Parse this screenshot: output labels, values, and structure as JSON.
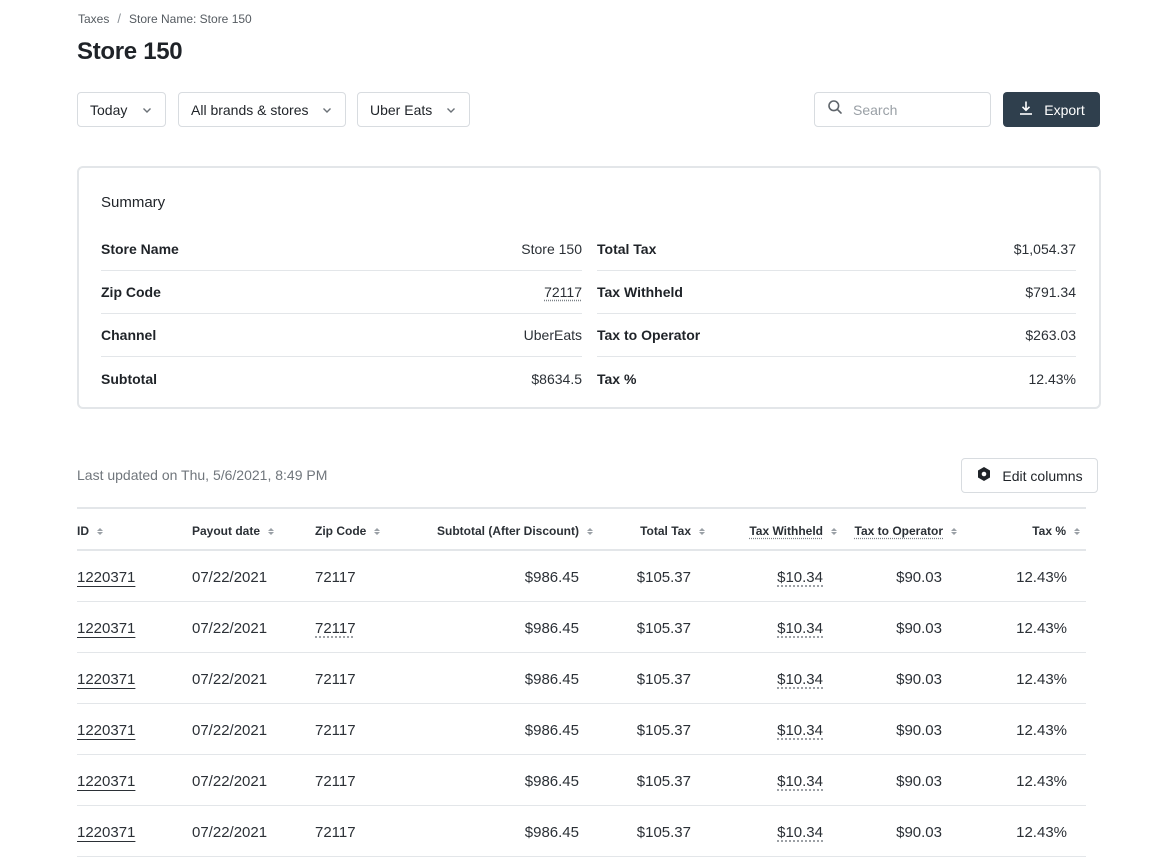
{
  "breadcrumb": {
    "root": "Taxes",
    "separator": "/",
    "current": "Store Name: Store 150"
  },
  "page_title": "Store 150",
  "filters": {
    "date": "Today",
    "brands": "All brands & stores",
    "channel": "Uber Eats"
  },
  "search": {
    "placeholder": "Search",
    "value": ""
  },
  "export_label": "Export",
  "summary": {
    "title": "Summary",
    "left": [
      {
        "label": "Store Name",
        "value": "Store 150"
      },
      {
        "label": "Zip Code",
        "value": "72117"
      },
      {
        "label": "Channel",
        "value": "UberEats"
      },
      {
        "label": "Subtotal",
        "value": "$8634.5"
      }
    ],
    "right": [
      {
        "label": "Total Tax",
        "value": "$1,054.37"
      },
      {
        "label": "Tax Withheld",
        "value": "$791.34"
      },
      {
        "label": "Tax to Operator",
        "value": "$263.03"
      },
      {
        "label": "Tax %",
        "value": "12.43%"
      }
    ]
  },
  "last_updated": "Last updated on Thu, 5/6/2021, 8:49 PM",
  "edit_columns_label": "Edit columns",
  "table": {
    "columns": [
      "ID",
      "Payout date",
      "Zip Code",
      "Subtotal (After Discount)",
      "Total Tax",
      "Tax Withheld",
      "Tax to Operator",
      "Tax %"
    ],
    "rows": [
      [
        "1220371",
        "07/22/2021",
        "72117",
        "$986.45",
        "$105.37",
        "$10.34",
        "$90.03",
        "12.43%"
      ],
      [
        "1220371",
        "07/22/2021",
        "72117",
        "$986.45",
        "$105.37",
        "$10.34",
        "$90.03",
        "12.43%"
      ],
      [
        "1220371",
        "07/22/2021",
        "72117",
        "$986.45",
        "$105.37",
        "$10.34",
        "$90.03",
        "12.43%"
      ],
      [
        "1220371",
        "07/22/2021",
        "72117",
        "$986.45",
        "$105.37",
        "$10.34",
        "$90.03",
        "12.43%"
      ],
      [
        "1220371",
        "07/22/2021",
        "72117",
        "$986.45",
        "$105.37",
        "$10.34",
        "$90.03",
        "12.43%"
      ],
      [
        "1220371",
        "07/22/2021",
        "72117",
        "$986.45",
        "$105.37",
        "$10.34",
        "$90.03",
        "12.43%"
      ]
    ]
  },
  "colors": {
    "primary_button": "#2f3f4d",
    "border": "#e3e6e9",
    "text": "#1f2328"
  }
}
